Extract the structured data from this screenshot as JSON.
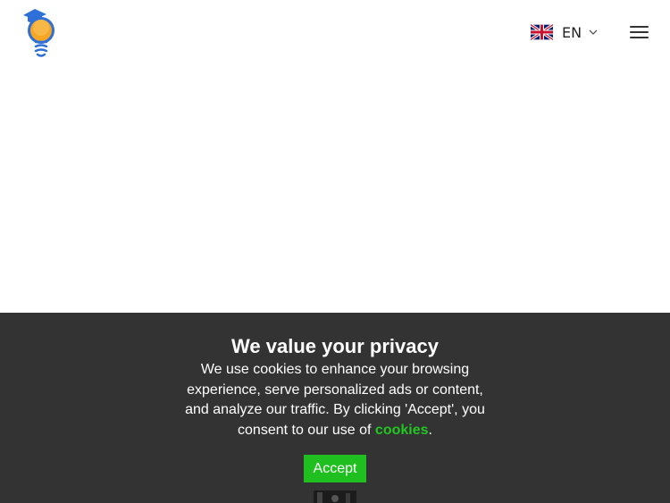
{
  "header": {
    "language": {
      "code": "EN",
      "flag_icon": "uk-flag-icon",
      "dropdown_icon": "chevron-down-icon"
    },
    "menu_icon": "hamburger-menu-icon",
    "logo_icon": "lightbulb-graduation-cap-logo"
  },
  "consent": {
    "title": "We value your privacy",
    "text": "We use cookies to enhance your browsing experience, serve personalized ads or content, and analyze our traffic. By clicking 'Accept', you consent to our use of",
    "link_label": "cookies",
    "trailing": ".",
    "accept_label": "Accept"
  },
  "colors": {
    "banner_background": "#333333",
    "accent_green": "#1fbf1f",
    "logo_blue": "#2f6fd8",
    "logo_orange": "#f5a623"
  }
}
